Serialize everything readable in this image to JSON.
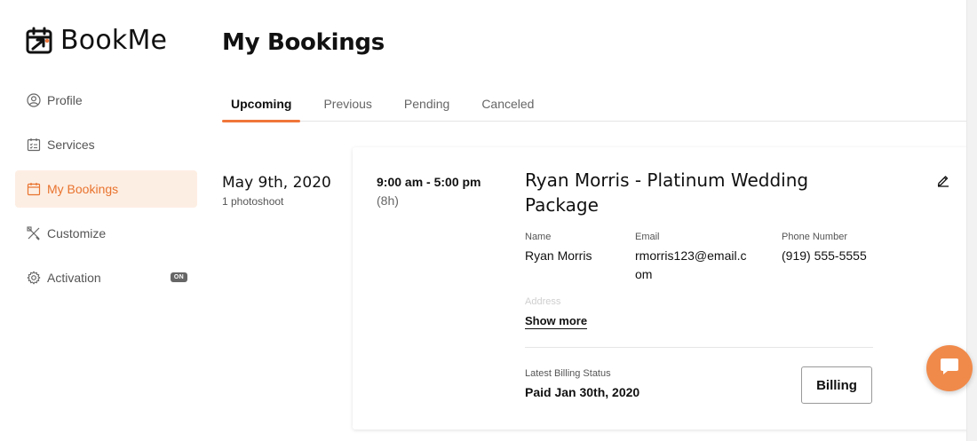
{
  "app": {
    "name": "BookMe",
    "accent": "#f0763a"
  },
  "sidebar": {
    "items": [
      {
        "label": "Profile",
        "icon": "user-circle-icon"
      },
      {
        "label": "Services",
        "icon": "checklist-icon"
      },
      {
        "label": "My Bookings",
        "icon": "calendar-icon",
        "active": true
      },
      {
        "label": "Customize",
        "icon": "tools-icon"
      },
      {
        "label": "Activation",
        "icon": "gear-icon",
        "badge": "ON"
      }
    ]
  },
  "page": {
    "title": "My Bookings"
  },
  "tabs": [
    {
      "label": "Upcoming",
      "active": true
    },
    {
      "label": "Previous"
    },
    {
      "label": "Pending"
    },
    {
      "label": "Canceled"
    }
  ],
  "booking": {
    "date": "May 9th, 2020",
    "count": "1 photoshoot",
    "time": "9:00 am - 5:00 pm",
    "duration": "(8h)",
    "title": "Ryan Morris - Platinum Wedding Package",
    "fields": {
      "name_label": "Name",
      "name_value": "Ryan Morris",
      "email_label": "Email",
      "email_value": "rmorris123@email.com",
      "phone_label": "Phone Number",
      "phone_value": "(919) 555-5555",
      "address_label": "Address"
    },
    "show_more": "Show more",
    "billing": {
      "label": "Latest Billing Status",
      "value": "Paid Jan 30th, 2020",
      "button": "Billing"
    }
  },
  "chat": {
    "icon": "chat-bubble-icon"
  }
}
